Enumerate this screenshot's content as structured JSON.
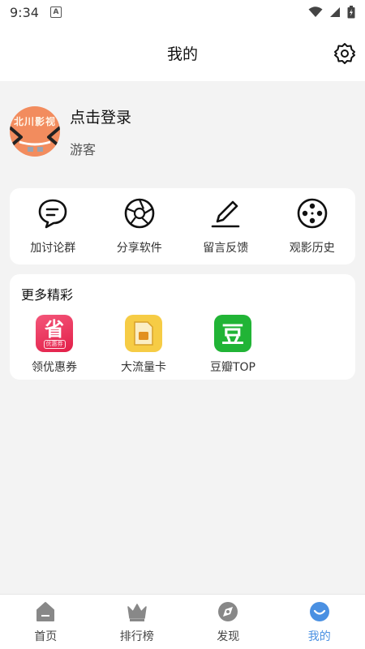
{
  "status": {
    "time": "9:34",
    "notif_badge": "A"
  },
  "header": {
    "title": "我的"
  },
  "profile": {
    "avatar_text": "北川影视",
    "login_label": "点击登录",
    "guest_label": "游客"
  },
  "actions": [
    {
      "label": "加讨论群",
      "icon": "chat-icon"
    },
    {
      "label": "分享软件",
      "icon": "aperture-icon"
    },
    {
      "label": "留言反馈",
      "icon": "pencil-icon"
    },
    {
      "label": "观影历史",
      "icon": "film-reel-icon"
    }
  ],
  "more": {
    "title": "更多精彩",
    "items": [
      {
        "label": "领优惠券",
        "icon_char": "省",
        "icon_sub": "优惠券",
        "color": "#ef3c5d"
      },
      {
        "label": "大流量卡",
        "color": "#f6cc45"
      },
      {
        "label": "豆瓣TOP",
        "icon_char": "豆",
        "color": "#21b436"
      }
    ]
  },
  "nav": [
    {
      "label": "首页"
    },
    {
      "label": "排行榜"
    },
    {
      "label": "发现"
    },
    {
      "label": "我的",
      "active": true
    }
  ],
  "colors": {
    "accent": "#4a90e2",
    "avatar_bg": "#f28c5e"
  }
}
